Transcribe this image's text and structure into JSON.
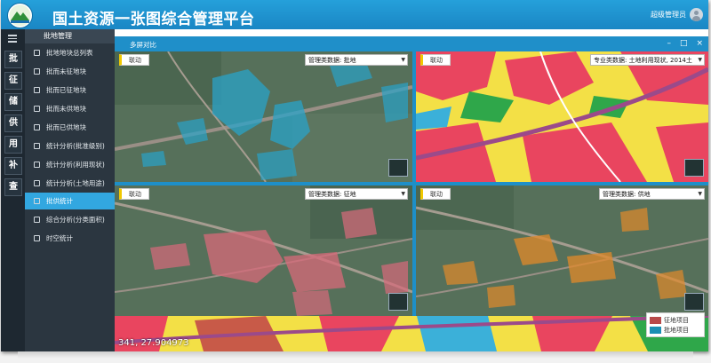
{
  "header": {
    "title": "国土资源一张图综合管理平台",
    "user_name": "超级管理员"
  },
  "strip": {
    "categories": [
      "批",
      "征",
      "储",
      "供",
      "用",
      "补",
      "查"
    ]
  },
  "sidebar": {
    "header": "批地管理",
    "items": [
      {
        "label": "批地地块总列表"
      },
      {
        "label": "批而未征地块"
      },
      {
        "label": "批而已征地块"
      },
      {
        "label": "批而未供地块"
      },
      {
        "label": "批而已供地块"
      },
      {
        "label": "统计分析(批准级别)"
      },
      {
        "label": "统计分析(利用现状)"
      },
      {
        "label": "统计分析(土地用途)"
      },
      {
        "label": "批供统计",
        "active": true
      },
      {
        "label": "综合分析(分类面积)"
      },
      {
        "label": "时空统计"
      }
    ]
  },
  "window": {
    "title": "多屏对比",
    "buttons": {
      "minimize": "–",
      "maximize": "□",
      "close": "×"
    }
  },
  "panes": [
    {
      "link_label": "联动",
      "layer": "管理类数据: 批地",
      "overlay_color": "#2aa3c8"
    },
    {
      "link_label": "联动",
      "layer": "专业类数据: 土地利用现状, 2014土",
      "overlay_color": "#e9455f"
    },
    {
      "link_label": "联动",
      "layer": "管理类数据: 征地",
      "overlay_color": "#d86a7a"
    },
    {
      "link_label": "联动",
      "layer": "管理类数据: 供地",
      "overlay_color": "#e38a2a"
    }
  ],
  "coordinates": "341, 27.904973",
  "legend": [
    {
      "label": "征地项目",
      "color": "#b84a4a"
    },
    {
      "label": "批地项目",
      "color": "#1a8fb4"
    }
  ],
  "colors": {
    "header": "#1f95d2",
    "sidebar": "#2b3640",
    "active_item": "#32a7e0"
  },
  "icons": {
    "logo": "mountain-logo-icon",
    "menu": "hamburger-icon",
    "user": "avatar-icon",
    "overview": "overview-map-icon"
  }
}
